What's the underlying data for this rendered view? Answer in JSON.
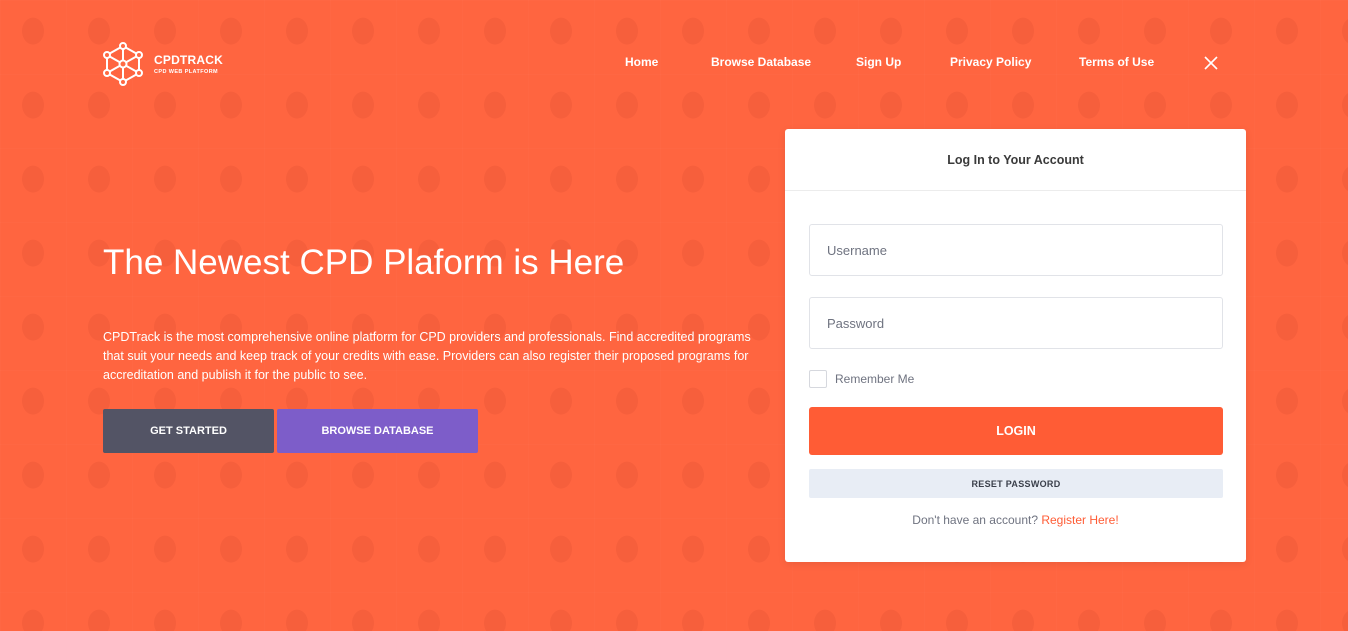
{
  "brand": {
    "name": "CPDTRACK",
    "tagline": "CPD WEB PLATFORM"
  },
  "nav": {
    "items": [
      "Home",
      "Browse Database",
      "Sign Up",
      "Privacy Policy",
      "Terms of Use"
    ],
    "close_icon": "close-icon"
  },
  "hero": {
    "title": "The Newest CPD Plaform is Here",
    "text": "CPDTrack is the most comprehensive online platform for CPD providers and professionals. Find accredited programs that suit your needs and keep track of your credits with ease. Providers can also register their proposed programs for accreditation and publish it for the public to see.",
    "get_started_label": "GET STARTED",
    "browse_label": "BROWSE DATABASE"
  },
  "login": {
    "title": "Log In to Your Account",
    "username_placeholder": "Username",
    "username_value": "",
    "password_placeholder": "Password",
    "password_value": "",
    "remember_label": "Remember Me",
    "login_label": "LOGIN",
    "reset_label": "RESET PASSWORD",
    "register_prompt": "Don't have an account?",
    "register_link": "Register Here!"
  },
  "colors": {
    "background": "#ff6a43",
    "accent": "#ff5c35",
    "button_dark": "#535465",
    "button_purple": "#7d5dc9",
    "reset_bg": "#e8edf5"
  }
}
